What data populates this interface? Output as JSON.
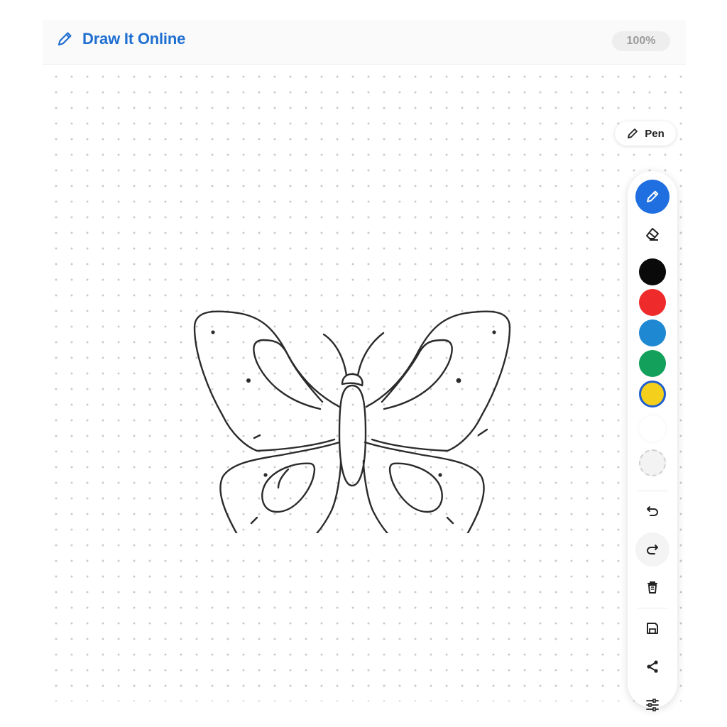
{
  "header": {
    "title": "Draw It Online",
    "zoom": "100%"
  },
  "tool_indicator": {
    "label": "Pen",
    "icon": "pencil-icon"
  },
  "toolbar": {
    "tools": [
      {
        "name": "pen",
        "icon": "pencil-icon",
        "active": true
      },
      {
        "name": "eraser",
        "icon": "eraser-icon",
        "active": false
      }
    ],
    "colors": [
      {
        "name": "black",
        "hex": "#0a0a0a"
      },
      {
        "name": "red",
        "hex": "#ee2a2a"
      },
      {
        "name": "blue",
        "hex": "#1e88d2"
      },
      {
        "name": "green",
        "hex": "#12a05a"
      },
      {
        "name": "yellow",
        "hex": "#f4cf1c",
        "selected": true
      },
      {
        "name": "white",
        "hex": "#ffffff"
      },
      {
        "name": "transparent",
        "hex": "transparent"
      }
    ],
    "actions": [
      {
        "name": "undo",
        "icon": "undo-icon"
      },
      {
        "name": "redo",
        "icon": "redo-icon"
      },
      {
        "name": "clear",
        "icon": "trash-icon"
      },
      {
        "name": "save",
        "icon": "save-icon"
      },
      {
        "name": "share",
        "icon": "share-icon"
      },
      {
        "name": "settings",
        "icon": "sliders-icon"
      }
    ]
  },
  "colors": {
    "accent": "#1f6fe0",
    "brand_text": "#1f6fd1",
    "stroke": "#2b2b2b"
  },
  "canvas": {
    "drawing": "butterfly-sketch"
  }
}
